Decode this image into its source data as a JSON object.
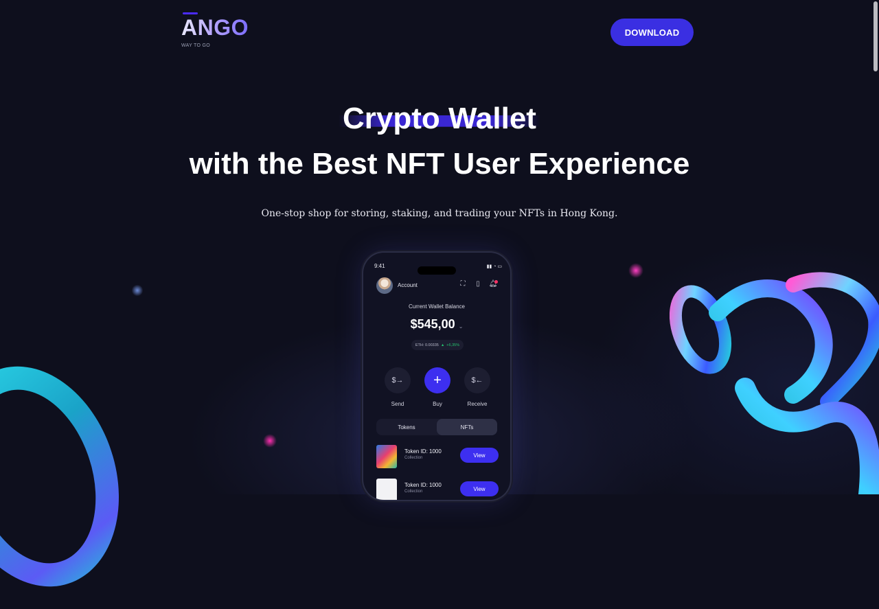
{
  "header": {
    "logo_text": "ANGO",
    "logo_tagline": "WAY TO GO",
    "download_label": "DOWNLOAD"
  },
  "hero": {
    "headline_line1": "Crypto Wallet",
    "headline_line2": "with the Best NFT User Experience",
    "subtitle": "One-stop shop for storing, staking, and trading your NFTs in Hong Kong."
  },
  "phone": {
    "status_time": "9:41",
    "account_label": "Account",
    "balance_label": "Current Wallet Balance",
    "balance_value": "$545,00",
    "eth_value": "ETH: 0.00335",
    "eth_change": "+6,35%",
    "actions": [
      {
        "label": "Send",
        "icon": "send-dollar-icon",
        "glyph": "$→"
      },
      {
        "label": "Buy",
        "icon": "plus-icon",
        "glyph": "+"
      },
      {
        "label": "Receive",
        "icon": "receive-dollar-icon",
        "glyph": "$←"
      }
    ],
    "tabs": [
      {
        "label": "Tokens",
        "active": false
      },
      {
        "label": "NFTs",
        "active": true
      }
    ],
    "nfts": [
      {
        "title": "Token ID: 1000",
        "subtitle": "Collection",
        "action": "View"
      },
      {
        "title": "Token ID: 1000",
        "subtitle": "Collection",
        "action": "View"
      }
    ]
  },
  "colors": {
    "background": "#0e0f1d",
    "accent": "#3a2fe2",
    "positive": "#25c26e"
  }
}
